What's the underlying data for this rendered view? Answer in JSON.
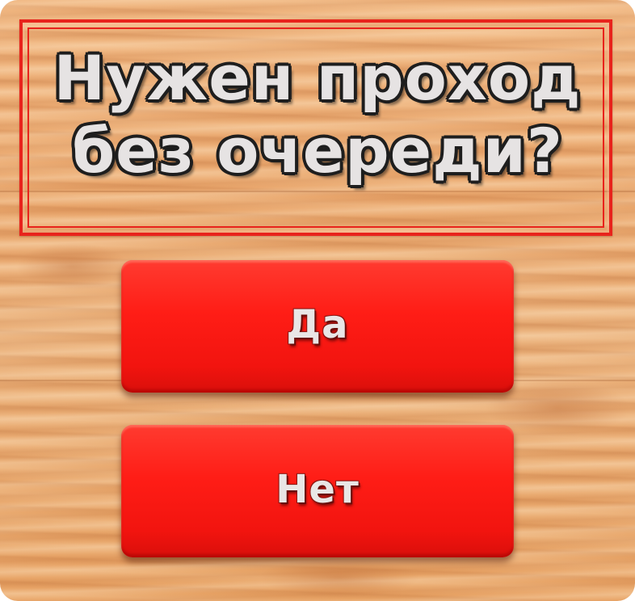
{
  "question": {
    "line1": "Нужен проход",
    "line2": "без очереди?"
  },
  "answers": [
    {
      "label": "Да"
    },
    {
      "label": "Нет"
    }
  ],
  "colors": {
    "frame": "#e8231c",
    "button": "#ff1d16",
    "wood": "#e8a46a",
    "text_fill": "#e6e3e3",
    "text_outline": "#262626"
  }
}
